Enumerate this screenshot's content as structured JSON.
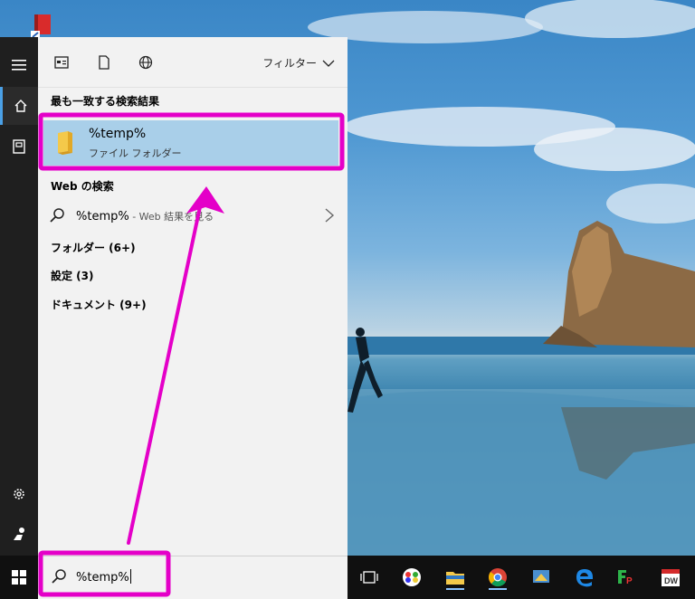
{
  "colors": {
    "accent_magenta": "#e400c8",
    "selection_blue": "#a9cfe9",
    "taskbar": "#101010",
    "panel": "#f2f2f2"
  },
  "rail": {
    "icons": [
      "hamburger-icon",
      "home-icon",
      "document-icon",
      "gear-icon",
      "user-icon"
    ]
  },
  "panel": {
    "top_icons": [
      "app-list-icon",
      "document-icon",
      "globe-icon"
    ],
    "filter_label": "フィルター",
    "best_match_header": "最も一致する検索結果",
    "best_match": {
      "title": "%temp%",
      "subtitle": "ファイル フォルダー"
    },
    "web_header": "Web の検索",
    "web_result": {
      "query": "%temp%",
      "suffix": " - Web 結果を見る"
    },
    "categories": [
      "フォルダー (6+)",
      "設定 (3)",
      "ドキュメント (9+)"
    ]
  },
  "taskbar": {
    "search_value": "%temp%",
    "apps": [
      "task-view-icon",
      "app-icon",
      "file-explorer-icon",
      "chrome-icon",
      "app-icon",
      "edge-icon",
      "ftp-icon",
      "dreamweaver-icon"
    ]
  }
}
